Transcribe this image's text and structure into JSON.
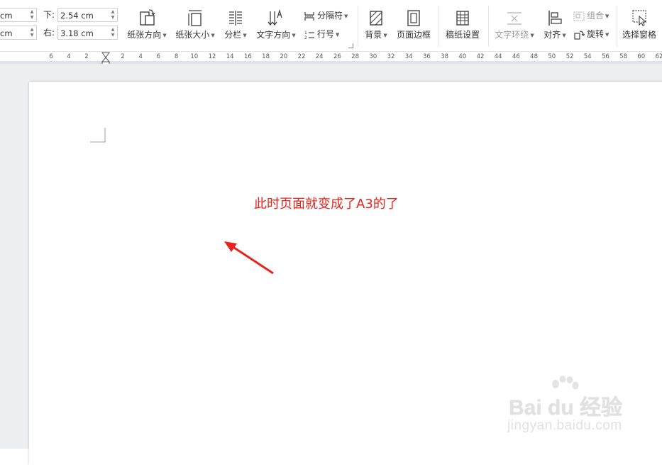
{
  "ribbon": {
    "margins": {
      "top_value": "cm",
      "left_value": "cm",
      "bottom_label": "下:",
      "bottom_value": "2.54 cm",
      "right_label": "右:",
      "right_value": "3.18 cm"
    },
    "buttons": {
      "orientation": "纸张方向",
      "size": "纸张大小",
      "columns": "分栏",
      "text_direction": "文字方向",
      "breaks": "分隔符",
      "line_numbers": "行号",
      "background": "背景",
      "page_border": "页面边框",
      "manuscript": "稿纸设置",
      "text_wrap": "文字环绕",
      "align": "对齐",
      "group": "组合",
      "rotate": "旋转",
      "selection_pane": "选择窗格"
    }
  },
  "ruler": {
    "ticks": [
      "6",
      "4",
      "2",
      "2",
      "4",
      "6",
      "8",
      "10",
      "12",
      "14",
      "16",
      "18",
      "20",
      "22",
      "24",
      "26",
      "28",
      "30",
      "32",
      "34",
      "36",
      "38",
      "40",
      "42",
      "44",
      "46",
      "48",
      "50",
      "52",
      "54",
      "56",
      "58",
      "60",
      "62"
    ]
  },
  "document": {
    "annotation": "此时页面就变成了A3的了",
    "annotation_color": "#e8231c"
  },
  "watermark": {
    "brand": "Bai du 经验",
    "url": "jingyan.baidu.com"
  }
}
